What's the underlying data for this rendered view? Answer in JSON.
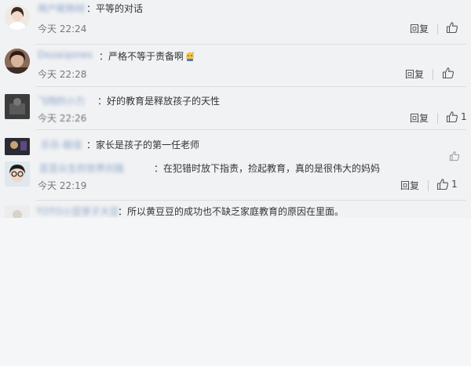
{
  "comments": [
    {
      "name": "用户昵称材",
      "colon": "：",
      "text": "平等的对话",
      "time": "今天 22:24",
      "reply": "回复",
      "likes": ""
    },
    {
      "name": "Dezaiqones",
      "colon": "：",
      "text": "严格不等于责备啊",
      "emoji": "cold-sweat-emoji",
      "time": "今天 22:28",
      "reply": "回复",
      "likes": ""
    },
    {
      "name": "飞翔的小力",
      "colon": "：",
      "text": "好的教育是释放孩子的天性",
      "time": "今天 22:26",
      "reply": "回复",
      "likes": "1"
    },
    {
      "name": "乐乐-聪佳",
      "colon": "：",
      "text": "家长是孩子的第一任老师",
      "time": "",
      "reply": "",
      "likes": ""
    },
    {
      "name": "芸芸众生的世界刘我",
      "colon": "：",
      "text": "在犯错时放下指责，捡起教育，真的是很伟大的妈妈",
      "time": "今天 22:19",
      "reply": "回复",
      "likes": "1"
    },
    {
      "name": "TOTO小豆芽子大豆芽",
      "colon": "：",
      "text": "所以黄豆豆的成功也不缺乏家庭教育的原因在里面。",
      "time": "",
      "reply": "",
      "likes": ""
    }
  ]
}
